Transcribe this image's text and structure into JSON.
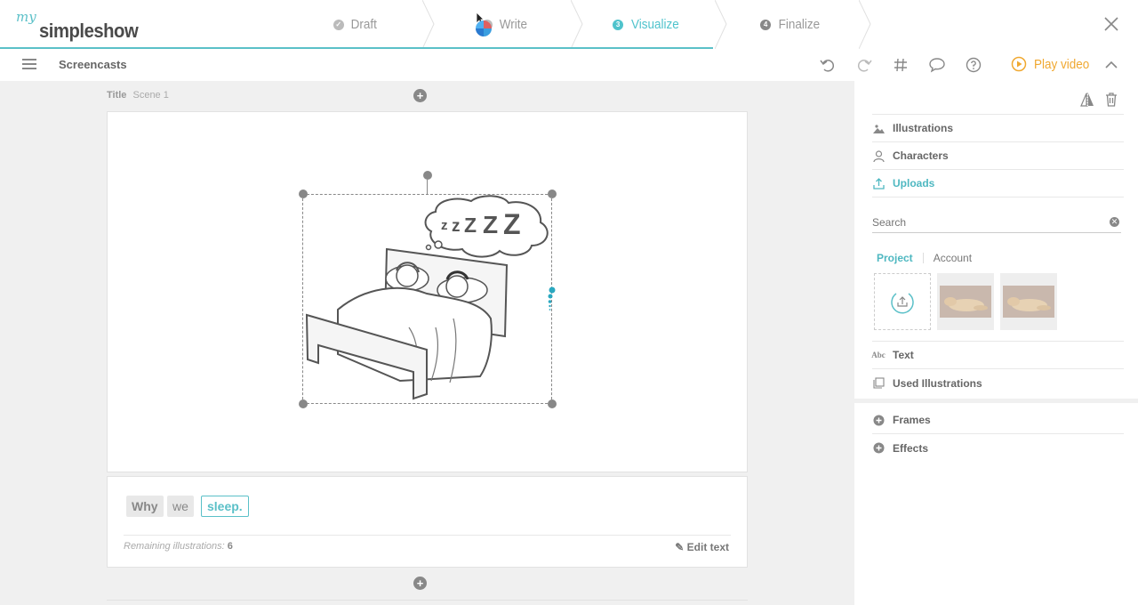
{
  "logo": {
    "prefix": "my",
    "name": "simpleshow"
  },
  "steps": [
    {
      "num": "",
      "label": "Draft"
    },
    {
      "num": "",
      "label": "Write"
    },
    {
      "num": "3",
      "label": "Visualize"
    },
    {
      "num": "4",
      "label": "Finalize"
    }
  ],
  "toolbar": {
    "project_title": "Screencasts",
    "play_label": "Play video"
  },
  "scene": {
    "title_label": "Title",
    "scene_name": "Scene 1",
    "words": [
      "Why",
      "we",
      "sleep."
    ],
    "remaining_label": "Remaining illustrations:",
    "remaining_count": "6",
    "edit_label": "Edit text"
  },
  "sidebar": {
    "categories": [
      "Illustrations",
      "Characters",
      "Uploads"
    ],
    "search_placeholder": "Search",
    "tabs": [
      "Project",
      "Account"
    ],
    "extra": [
      "Text",
      "Used Illustrations"
    ],
    "sections": [
      "Frames",
      "Effects"
    ]
  },
  "colors": {
    "accent": "#5bc0c8",
    "play": "#f0a830"
  }
}
